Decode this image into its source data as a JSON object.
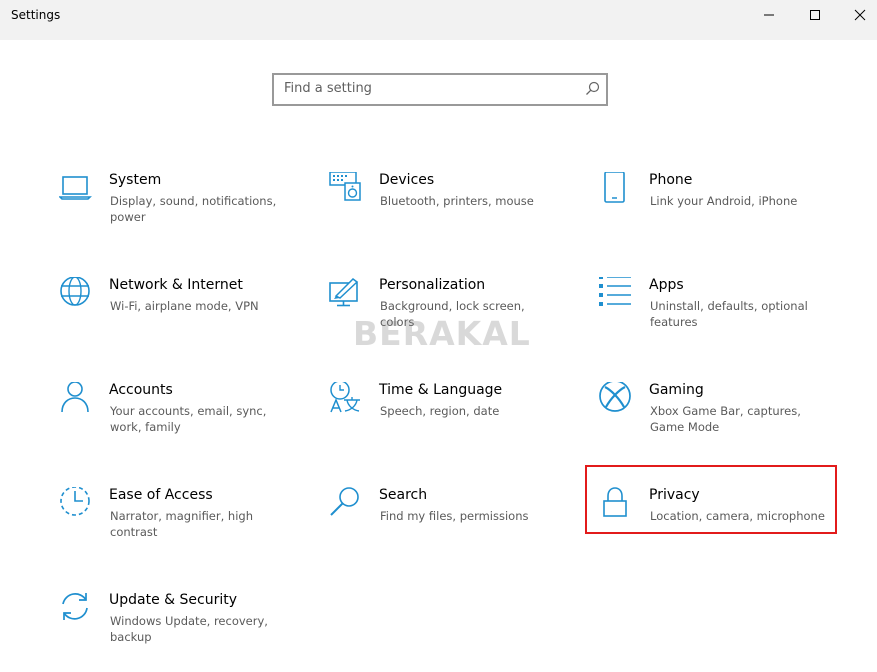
{
  "window": {
    "title": "Settings"
  },
  "search": {
    "placeholder": "Find a setting"
  },
  "accent_color": "#1f8fcf",
  "highlight_color": "#e21b1b",
  "watermark": "BERAKAL",
  "tiles": [
    {
      "label": "System",
      "desc": "Display, sound, notifications, power",
      "icon": "laptop-icon"
    },
    {
      "label": "Devices",
      "desc": "Bluetooth, printers, mouse",
      "icon": "devices-icon"
    },
    {
      "label": "Phone",
      "desc": "Link your Android, iPhone",
      "icon": "phone-icon"
    },
    {
      "label": "Network & Internet",
      "desc": "Wi-Fi, airplane mode, VPN",
      "icon": "globe-icon"
    },
    {
      "label": "Personalization",
      "desc": "Background, lock screen, colors",
      "icon": "personalization-icon"
    },
    {
      "label": "Apps",
      "desc": "Uninstall, defaults, optional features",
      "icon": "apps-list-icon"
    },
    {
      "label": "Accounts",
      "desc": "Your accounts, email, sync, work, family",
      "icon": "person-icon"
    },
    {
      "label": "Time & Language",
      "desc": "Speech, region, date",
      "icon": "time-language-icon"
    },
    {
      "label": "Gaming",
      "desc": "Xbox Game Bar, captures, Game Mode",
      "icon": "xbox-icon"
    },
    {
      "label": "Ease of Access",
      "desc": "Narrator, magnifier, high contrast",
      "icon": "ease-of-access-icon"
    },
    {
      "label": "Search",
      "desc": "Find my files, permissions",
      "icon": "search-icon"
    },
    {
      "label": "Privacy",
      "desc": "Location, camera, microphone",
      "icon": "lock-icon"
    },
    {
      "label": "Update & Security",
      "desc": "Windows Update, recovery, backup",
      "icon": "update-icon"
    }
  ]
}
